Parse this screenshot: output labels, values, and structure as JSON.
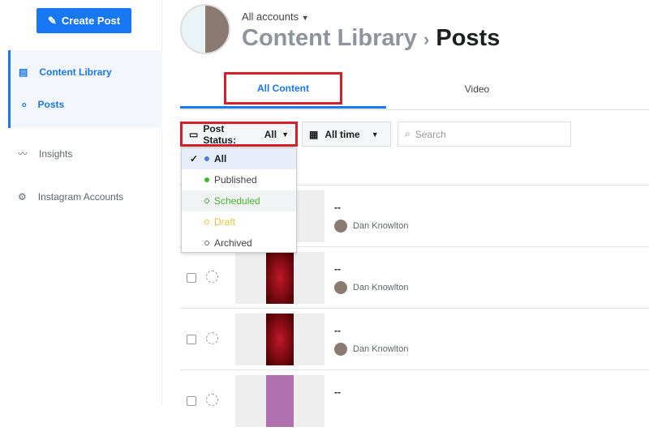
{
  "sidebar": {
    "create_post": "Create Post",
    "items": [
      {
        "label": "Content Library"
      },
      {
        "label": "Posts"
      },
      {
        "label": "Insights"
      },
      {
        "label": "Instagram Accounts"
      }
    ]
  },
  "header": {
    "accounts": "All accounts",
    "title": "Content Library",
    "separator": "›",
    "subtitle": "Posts"
  },
  "tabs": [
    {
      "label": "All Content",
      "active": true
    },
    {
      "label": "Video"
    }
  ],
  "filters": {
    "post_status_label": "Post Status:",
    "post_status_value": "All",
    "time": "All time",
    "search_placeholder": "Search"
  },
  "status_menu": [
    {
      "label": "All",
      "color": "#4a7fe0",
      "selected": true
    },
    {
      "label": "Published",
      "color": "#42b72a"
    },
    {
      "label": "Scheduled",
      "color": "#42b72a"
    },
    {
      "label": "Draft",
      "color": "#e8c23a"
    },
    {
      "label": "Archived",
      "color": "#606770"
    }
  ],
  "posts": [
    {
      "title": "--",
      "author": "Dan Knowlton"
    },
    {
      "title": "--",
      "author": "Dan Knowlton"
    },
    {
      "title": "--",
      "author": "Dan Knowlton"
    },
    {
      "title": "--"
    }
  ],
  "colors": {
    "accent": "#1877f2",
    "highlight": "#d0202a"
  }
}
